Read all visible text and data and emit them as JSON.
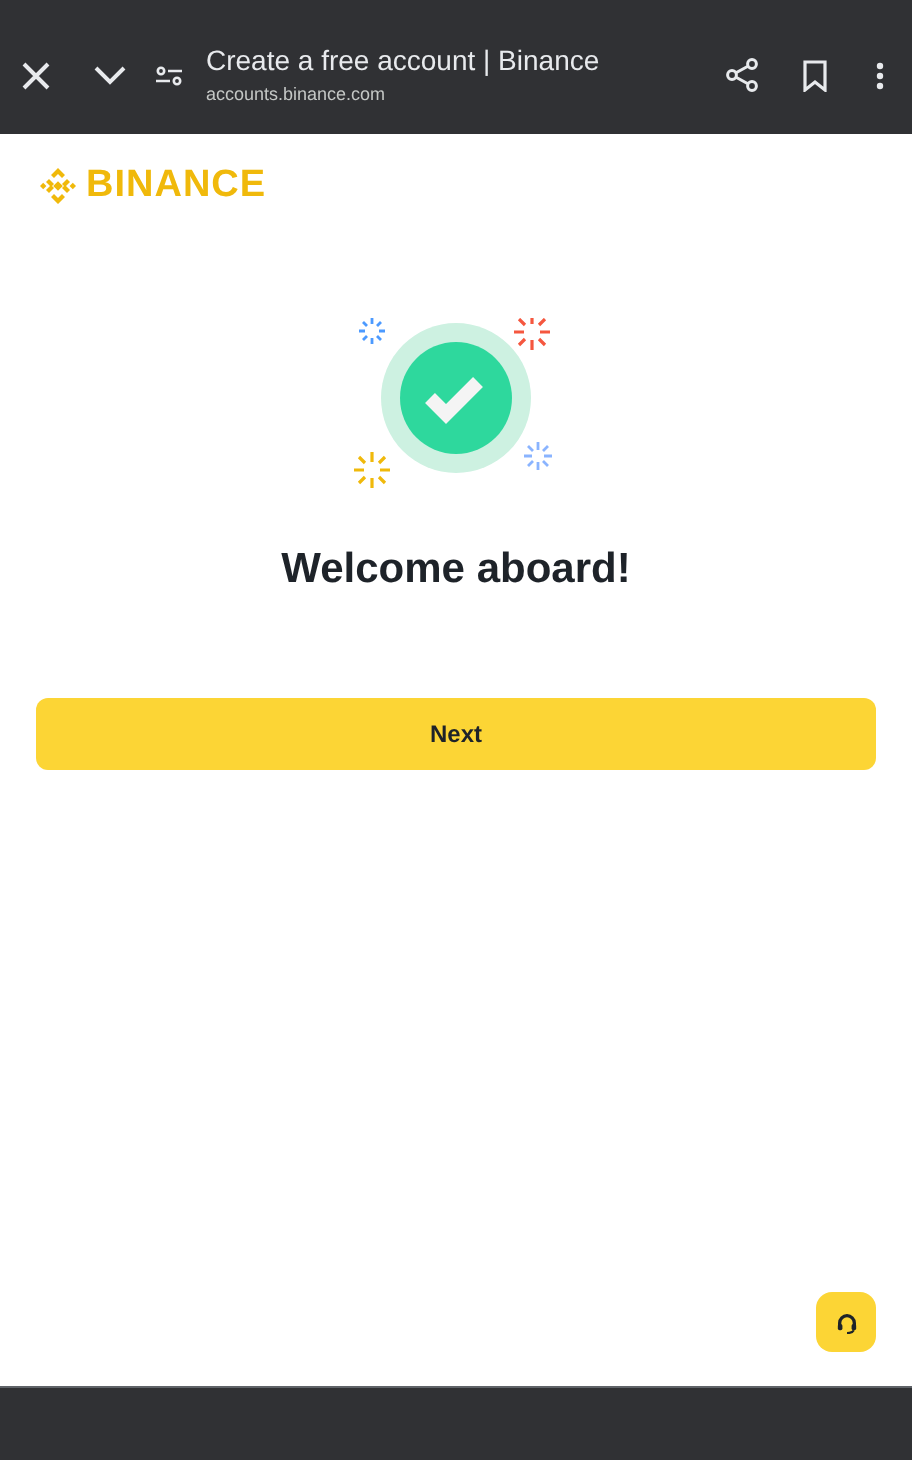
{
  "browser": {
    "title": "Create a free account | Binance",
    "url": "accounts.binance.com"
  },
  "logo": {
    "text": "BINANCE"
  },
  "heading": "Welcome aboard!",
  "primary_button": {
    "label": "Next"
  }
}
